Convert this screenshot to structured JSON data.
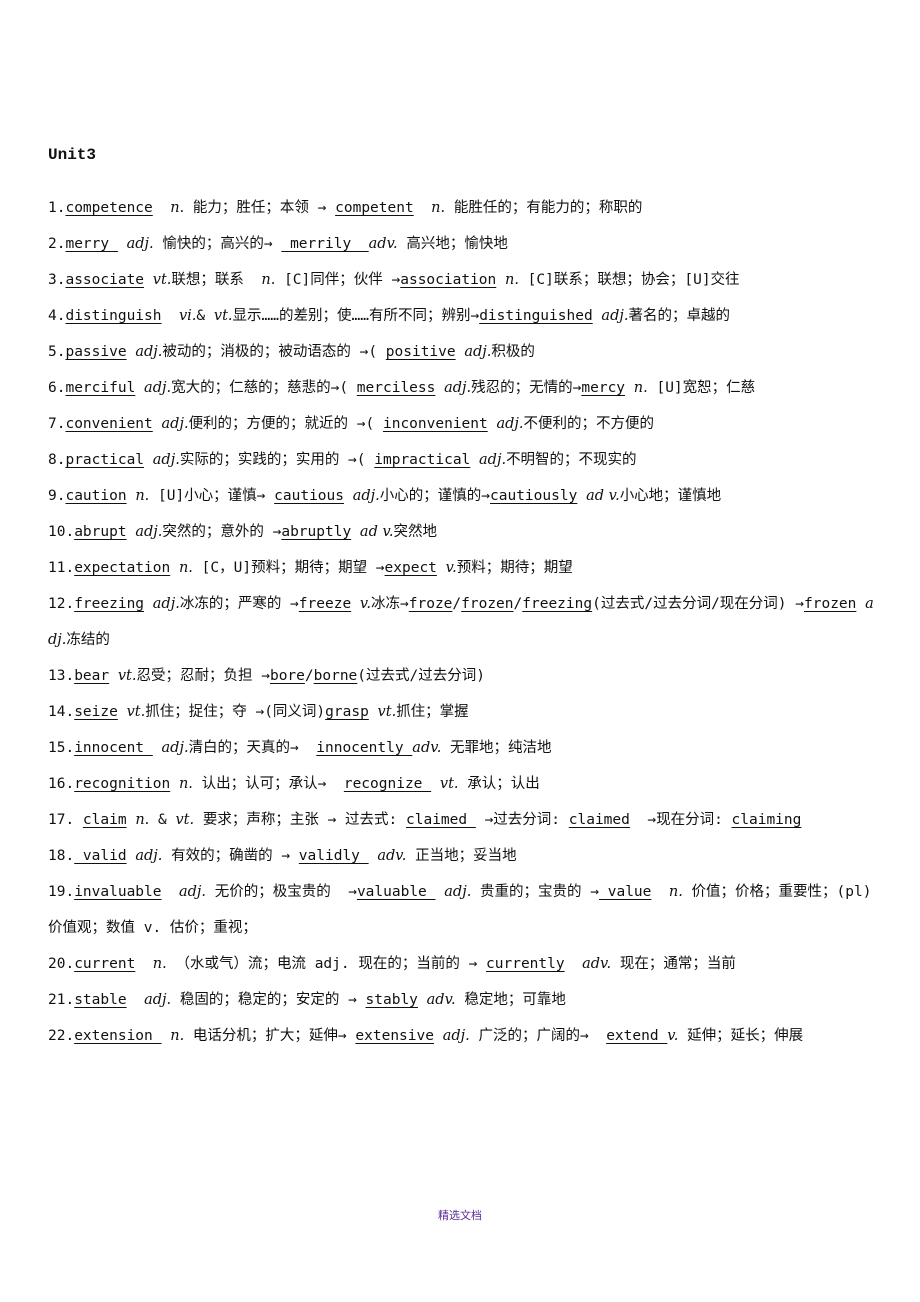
{
  "title": "Unit3",
  "entries": [
    {
      "num": "1.",
      "parts": [
        {
          "t": "competence",
          "u": true
        },
        {
          "t": "  "
        },
        {
          "t": "n.",
          "pos": true
        },
        {
          "t": " 能力；胜任；本领 → "
        },
        {
          "t": "competent",
          "u": true
        },
        {
          "t": "  "
        },
        {
          "t": "n.",
          "pos": true
        },
        {
          "t": " 能胜任的；有能力的；称职的"
        }
      ]
    },
    {
      "num": "2.",
      "parts": [
        {
          "t": "merry ",
          "u": true
        },
        {
          "t": " "
        },
        {
          "t": "adj.",
          "pos": true
        },
        {
          "t": " 愉快的；高兴的→ "
        },
        {
          "t": " merrily  ",
          "u": true
        },
        {
          "t": "adv.",
          "pos": true
        },
        {
          "t": " 高兴地；愉快地"
        }
      ]
    },
    {
      "num": "3.",
      "parts": [
        {
          "t": "associate",
          "u": true
        },
        {
          "t": " "
        },
        {
          "t": "vt.",
          "pos": true
        },
        {
          "t": "联想；联系  "
        },
        {
          "t": "n.",
          "pos": true
        },
        {
          "t": " [C]同伴；伙伴 →"
        },
        {
          "t": "association",
          "u": true
        },
        {
          "t": " "
        },
        {
          "t": "n.",
          "pos": true
        },
        {
          "t": " [C]联系；联想；协会；[U]交往"
        }
      ]
    },
    {
      "num": "4.",
      "parts": [
        {
          "t": "distinguish",
          "u": true
        },
        {
          "t": "  "
        },
        {
          "t": "vi.",
          "pos": true
        },
        {
          "t": "& "
        },
        {
          "t": "vt.",
          "pos": true
        },
        {
          "t": "显示……的差别；使……有所不同；辨别→"
        },
        {
          "t": "distinguished",
          "u": true
        },
        {
          "t": " "
        },
        {
          "t": "adj.",
          "pos": true
        },
        {
          "t": "著名的；卓越的"
        }
      ]
    },
    {
      "num": "5.",
      "parts": [
        {
          "t": "passive",
          "u": true
        },
        {
          "t": " "
        },
        {
          "t": "adj.",
          "pos": true
        },
        {
          "t": "被动的；消极的；被动语态的 →( "
        },
        {
          "t": "positive",
          "u": true
        },
        {
          "t": " "
        },
        {
          "t": "adj.",
          "pos": true
        },
        {
          "t": "积极的"
        }
      ]
    },
    {
      "num": "6.",
      "parts": [
        {
          "t": "merciful",
          "u": true
        },
        {
          "t": " "
        },
        {
          "t": "adj.",
          "pos": true
        },
        {
          "t": "宽大的；仁慈的；慈悲的→( "
        },
        {
          "t": "merciless",
          "u": true
        },
        {
          "t": " "
        },
        {
          "t": "adj.",
          "pos": true
        },
        {
          "t": "残忍的；无情的→"
        },
        {
          "t": "mercy",
          "u": true
        },
        {
          "t": " "
        },
        {
          "t": "n.",
          "pos": true
        },
        {
          "t": " [U]宽恕；仁慈"
        }
      ]
    },
    {
      "num": "7.",
      "parts": [
        {
          "t": "convenient",
          "u": true
        },
        {
          "t": " "
        },
        {
          "t": "adj.",
          "pos": true
        },
        {
          "t": "便利的；方便的；就近的 →( "
        },
        {
          "t": "inconvenient",
          "u": true
        },
        {
          "t": " "
        },
        {
          "t": "adj.",
          "pos": true
        },
        {
          "t": "不便利的；不方便的"
        }
      ]
    },
    {
      "num": "8.",
      "parts": [
        {
          "t": "practical",
          "u": true
        },
        {
          "t": " "
        },
        {
          "t": "adj.",
          "pos": true
        },
        {
          "t": "实际的；实践的；实用的 →( "
        },
        {
          "t": "impractical",
          "u": true
        },
        {
          "t": " "
        },
        {
          "t": "adj.",
          "pos": true
        },
        {
          "t": "不明智的；不现实的"
        }
      ]
    },
    {
      "num": "9.",
      "parts": [
        {
          "t": "caution",
          "u": true
        },
        {
          "t": " "
        },
        {
          "t": "n.",
          "pos": true
        },
        {
          "t": " [U]小心；谨慎→ "
        },
        {
          "t": "cautious",
          "u": true
        },
        {
          "t": " "
        },
        {
          "t": "adj.",
          "pos": true
        },
        {
          "t": "小心的；谨慎的→"
        },
        {
          "t": "cautiously",
          "u": true
        },
        {
          "t": " "
        },
        {
          "t": "ad v.",
          "pos": true
        },
        {
          "t": "小心地；谨慎地"
        }
      ]
    },
    {
      "num": "10.",
      "parts": [
        {
          "t": "abrupt",
          "u": true
        },
        {
          "t": " "
        },
        {
          "t": "adj.",
          "pos": true
        },
        {
          "t": "突然的；意外的 →"
        },
        {
          "t": "abruptly",
          "u": true
        },
        {
          "t": " "
        },
        {
          "t": "ad v.",
          "pos": true
        },
        {
          "t": "突然地"
        }
      ]
    },
    {
      "num": "11.",
      "parts": [
        {
          "t": "expectation",
          "u": true
        },
        {
          "t": " "
        },
        {
          "t": "n.",
          "pos": true
        },
        {
          "t": " [C，U]预料；期待；期望 →"
        },
        {
          "t": "expect",
          "u": true
        },
        {
          "t": " "
        },
        {
          "t": "v.",
          "pos": true
        },
        {
          "t": "预料；期待；期望"
        }
      ]
    },
    {
      "num": "12.",
      "parts": [
        {
          "t": "freezing",
          "u": true
        },
        {
          "t": " "
        },
        {
          "t": "adj.",
          "pos": true
        },
        {
          "t": "冰冻的；严寒的 →"
        },
        {
          "t": "freeze",
          "u": true
        },
        {
          "t": " "
        },
        {
          "t": "v.",
          "pos": true
        },
        {
          "t": "冰冻→"
        },
        {
          "t": "froze",
          "u": true
        },
        {
          "t": "/"
        },
        {
          "t": "frozen",
          "u": true
        },
        {
          "t": "/"
        },
        {
          "t": "freezing",
          "u": true
        },
        {
          "t": "(过去式/过去分词/现在分词) →"
        },
        {
          "t": "frozen",
          "u": true
        },
        {
          "t": " "
        },
        {
          "t": "adj.",
          "pos": true
        },
        {
          "t": "冻结的"
        }
      ]
    },
    {
      "num": "13.",
      "parts": [
        {
          "t": "bear",
          "u": true
        },
        {
          "t": " "
        },
        {
          "t": "vt.",
          "pos": true
        },
        {
          "t": "忍受；忍耐；负担 →"
        },
        {
          "t": "bore",
          "u": true
        },
        {
          "t": "/"
        },
        {
          "t": "borne",
          "u": true
        },
        {
          "t": "(过去式/过去分词)"
        }
      ]
    },
    {
      "num": "14.",
      "parts": [
        {
          "t": "seize",
          "u": true
        },
        {
          "t": " "
        },
        {
          "t": "vt.",
          "pos": true
        },
        {
          "t": "抓住；捉住；夺 →(同义词)"
        },
        {
          "t": "grasp",
          "u": true
        },
        {
          "t": " "
        },
        {
          "t": "vt.",
          "pos": true
        },
        {
          "t": "抓住；掌握"
        }
      ]
    },
    {
      "num": "15.",
      "parts": [
        {
          "t": "innocent ",
          "u": true
        },
        {
          "t": " "
        },
        {
          "t": "adj.",
          "pos": true
        },
        {
          "t": "清白的；天真的→  "
        },
        {
          "t": "innocently ",
          "u": true
        },
        {
          "t": "adv.",
          "pos": true
        },
        {
          "t": " 无罪地；纯洁地"
        }
      ]
    },
    {
      "num": "16.",
      "parts": [
        {
          "t": "recognition",
          "u": true
        },
        {
          "t": " "
        },
        {
          "t": "n.",
          "pos": true
        },
        {
          "t": " 认出；认可；承认→  "
        },
        {
          "t": "recognize ",
          "u": true
        },
        {
          "t": " "
        },
        {
          "t": "vt.",
          "pos": true
        },
        {
          "t": " 承认；认出"
        }
      ]
    },
    {
      "num": "17. ",
      "nowrap": true,
      "parts": [
        {
          "t": "claim",
          "u": true
        },
        {
          "t": " "
        },
        {
          "t": "n.",
          "pos": true
        },
        {
          "t": " & "
        },
        {
          "t": "vt.",
          "pos": true
        },
        {
          "t": " 要求；声称；主张 → 过去式: "
        },
        {
          "t": "claimed ",
          "u": true
        },
        {
          "t": " →过去分词: "
        },
        {
          "t": "claimed",
          "u": true
        },
        {
          "t": "  →现在分词: "
        },
        {
          "t": "claiming",
          "u": true
        }
      ]
    },
    {
      "num": "18.",
      "parts": [
        {
          "t": " valid",
          "u": true
        },
        {
          "t": " "
        },
        {
          "t": "adj.",
          "pos": true
        },
        {
          "t": " 有效的；确凿的 → "
        },
        {
          "t": "validly ",
          "u": true
        },
        {
          "t": " "
        },
        {
          "t": "adv.",
          "pos": true
        },
        {
          "t": " 正当地；妥当地"
        }
      ]
    },
    {
      "num": "19.",
      "parts": [
        {
          "t": "invaluable",
          "u": true
        },
        {
          "t": "  "
        },
        {
          "t": "adj.",
          "pos": true
        },
        {
          "t": " 无价的；极宝贵的  →"
        },
        {
          "t": "valuable ",
          "u": true
        },
        {
          "t": " "
        },
        {
          "t": "adj.",
          "pos": true
        },
        {
          "t": " 贵重的；宝贵的 →"
        },
        {
          "t": " value",
          "u": true
        },
        {
          "t": "  "
        },
        {
          "t": "n.",
          "pos": true
        },
        {
          "t": " 价值；价格；重要性；(pl)价值观；数值 v. 估价；重视；"
        }
      ]
    },
    {
      "num": "20.",
      "parts": [
        {
          "t": "current",
          "u": true
        },
        {
          "t": "  "
        },
        {
          "t": "n.",
          "pos": true
        },
        {
          "t": " （水或气）流；电流 adj. 现在的；当前的 → "
        },
        {
          "t": "currently",
          "u": true
        },
        {
          "t": "  "
        },
        {
          "t": "adv.",
          "pos": true
        },
        {
          "t": " 现在；通常；当前"
        }
      ]
    },
    {
      "num": "21.",
      "parts": [
        {
          "t": "stable",
          "u": true
        },
        {
          "t": "  "
        },
        {
          "t": "adj.",
          "pos": true
        },
        {
          "t": " 稳固的；稳定的；安定的 → "
        },
        {
          "t": "stably",
          "u": true
        },
        {
          "t": " "
        },
        {
          "t": "adv.",
          "pos": true
        },
        {
          "t": " 稳定地；可靠地"
        }
      ]
    },
    {
      "num": "22.",
      "parts": [
        {
          "t": "extension ",
          "u": true
        },
        {
          "t": " "
        },
        {
          "t": "n.",
          "pos": true
        },
        {
          "t": " 电话分机；扩大；延伸→ "
        },
        {
          "t": "extensive",
          "u": true
        },
        {
          "t": " "
        },
        {
          "t": "adj.",
          "pos": true
        },
        {
          "t": " 广泛的；广阔的→  "
        },
        {
          "t": "extend ",
          "u": true
        },
        {
          "t": "v.",
          "pos": true
        },
        {
          "t": " 延伸；延长；伸展"
        }
      ]
    }
  ],
  "footer": "精选文档"
}
